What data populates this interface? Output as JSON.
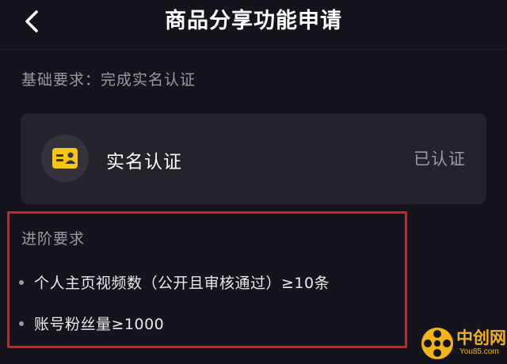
{
  "header": {
    "title": "商品分享功能申请"
  },
  "basic_requirement": {
    "text": "基础要求：完成实名认证"
  },
  "card": {
    "label": "实名认证",
    "status": "已认证"
  },
  "advanced": {
    "title": "进阶要求",
    "items": [
      {
        "text": "个人主页视频数（公开且审核通过）≥10条"
      },
      {
        "text": "账号粉丝量≥1000"
      }
    ]
  },
  "watermark": {
    "brand": "中创网",
    "url": "You85.com"
  },
  "colors": {
    "background": "#15141c",
    "card": "#24232b",
    "highlight_border": "#d81e1e",
    "id_icon": "#f5c518"
  }
}
